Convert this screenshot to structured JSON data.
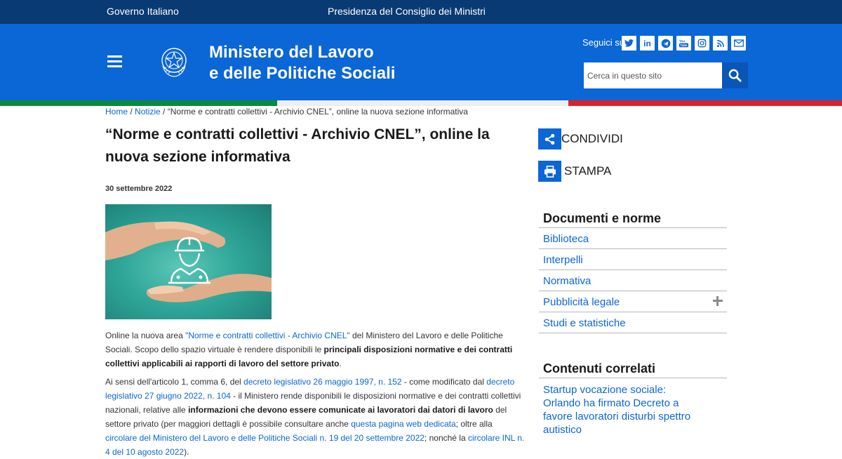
{
  "topbar": {
    "gov": "Governo Italiano",
    "pres": "Presidenza del Consiglio dei Ministri"
  },
  "header": {
    "title_line1": "Ministero del Lavoro",
    "title_line2": "e delle Politiche Sociali",
    "follow_label": "Seguici su:",
    "social": [
      "twitter-icon",
      "linkedin-icon",
      "telegram-icon",
      "youtube-icon",
      "instagram-icon",
      "rss-icon",
      "mail-icon"
    ],
    "search_placeholder": "Cerca in questo sito"
  },
  "breadcrumb": {
    "home": "Home",
    "sep1": " / ",
    "news": "Notizie",
    "sep2": " / ",
    "current": "“Norme e contratti collettivi - Archivio CNEL”, online la nuova sezione informativa"
  },
  "article": {
    "title": "“Norme e contratti collettivi - Archivio CNEL”, online la nuova sezione informativa",
    "date": "30 settembre 2022",
    "p1_a": "Online la nuova area ",
    "p1_link": "\"Norme e contratti collettivi - Archivio CNEL\"",
    "p1_b": " del Ministero del Lavoro e delle Politiche Sociali. Scopo dello spazio virtuale è rendere disponibili le ",
    "p1_bold": "principali disposizioni normative e dei contratti collettivi applicabili ai rapporti di lavoro del settore privato",
    "p1_c": ".",
    "p2_a": "Ai sensi dell'articolo 1, comma 6, del ",
    "p2_link1": "decreto legislativo 26 maggio 1997, n. 152",
    "p2_b": " - come modificato dal ",
    "p2_link2": "decreto legislativo 27 giugno 2022, n. 104",
    "p2_c": " - il Ministero rende disponibili le disposizioni normative e dei contratti collettivi nazionali, relative alle ",
    "p2_bold": "informazioni che devono essere comunicate ai lavoratori dai datori di lavoro",
    "p2_d": " del settore privato (per maggiori dettagli è possibile consultare anche ",
    "p2_link3": "questa pagina web dedicata",
    "p2_e": "; oltre alla ",
    "p2_link4": "circolare del Ministero del Lavoro e delle Politiche Sociali n. 19 del 20 settembre 2022",
    "p2_f": "; nonché la ",
    "p2_link5": "circolare INL n. 4 del 10 agosto 2022",
    "p2_g": ")."
  },
  "sidebar": {
    "share": "CONDIVIDI",
    "print": "STAMPA",
    "docs_heading": "Documenti e norme",
    "items": [
      "Biblioteca",
      "Interpelli",
      "Normativa",
      "Pubblicità legale",
      "Studi e statistiche"
    ],
    "related_heading": "Contenuti correlati",
    "related_link": "Startup vocazione sociale: Orlando ha firmato Decreto a favore lavoratori disturbi spettro autistico"
  },
  "colors": {
    "topbar": "#0a3a73",
    "header": "#0b66d6",
    "link": "#0b66d6",
    "flag_green": "#0b8a3e",
    "flag_red": "#d8232a"
  }
}
